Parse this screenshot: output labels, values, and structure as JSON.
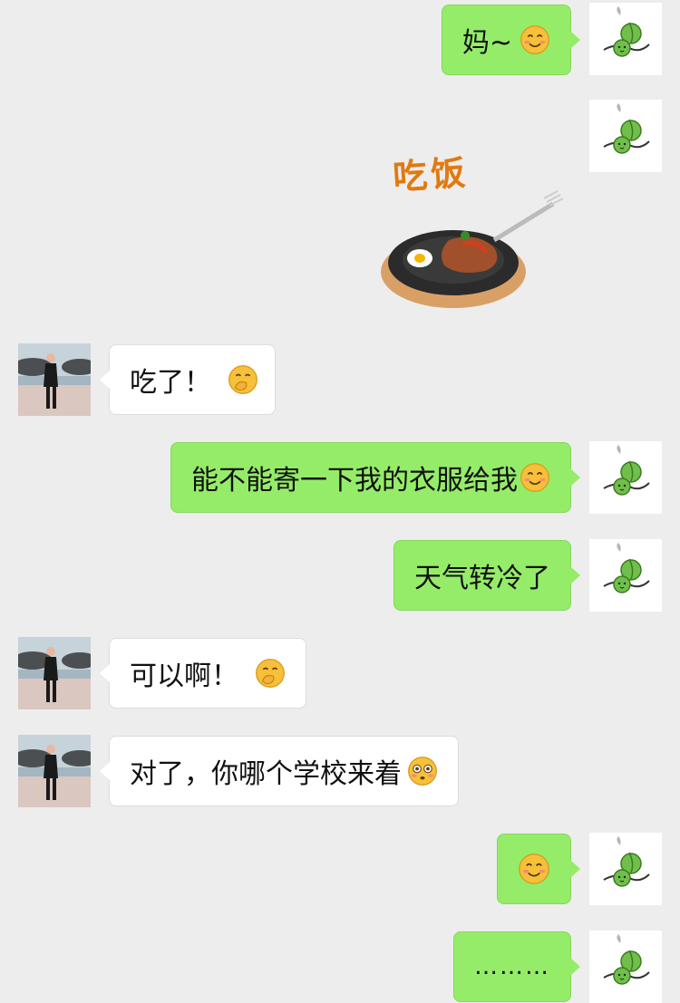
{
  "colors": {
    "background": "#ededed",
    "self_bubble": "#95ec69",
    "other_bubble": "#ffffff"
  },
  "messages": [
    {
      "side": "self",
      "text": "妈~",
      "emoji": "smiling-face-icon"
    },
    {
      "side": "self",
      "type": "sticker",
      "sticker_text": "吃饭",
      "sticker_icon": "steak-plate-icon"
    },
    {
      "side": "other",
      "text": "吃了！",
      "emoji": "giggle-face-icon"
    },
    {
      "side": "self",
      "text": "能不能寄一下我的衣服给我",
      "emoji": "smiling-face-icon"
    },
    {
      "side": "self",
      "text": "天气转冷了"
    },
    {
      "side": "other",
      "text": "可以啊！",
      "emoji": "giggle-face-icon"
    },
    {
      "side": "other",
      "text": "对了，你哪个学校来着",
      "emoji": "flushed-face-icon"
    },
    {
      "side": "self",
      "text": "",
      "emoji": "smiling-face-icon"
    },
    {
      "side": "self",
      "text": "………"
    }
  ]
}
